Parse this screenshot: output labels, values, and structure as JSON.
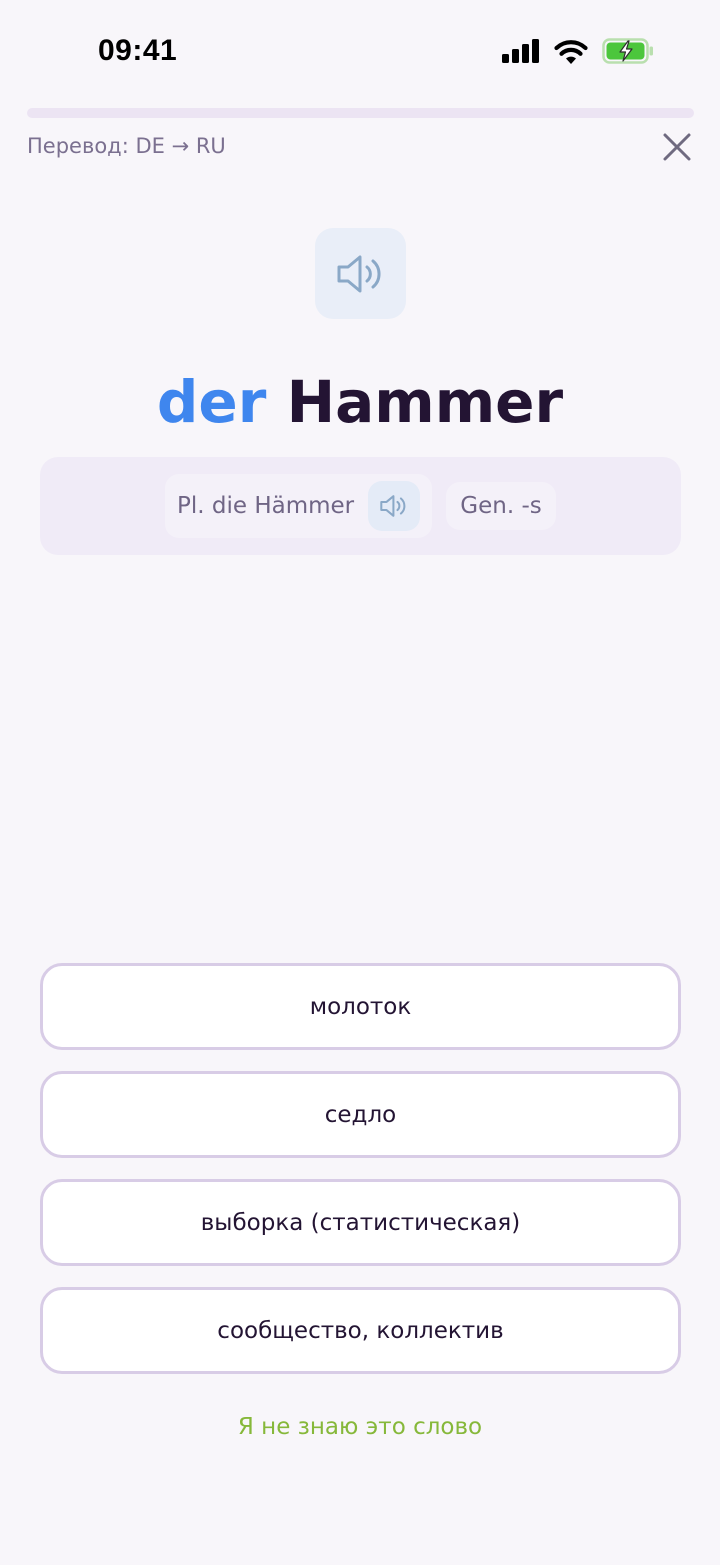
{
  "status_bar": {
    "time": "09:41",
    "icons": [
      "cellular-signal-icon",
      "wifi-icon",
      "battery-charging-icon"
    ]
  },
  "progress": {
    "value": 0
  },
  "header": {
    "mode_label": "Перевод: DE → RU",
    "close_icon": "close-icon"
  },
  "word": {
    "article": "der",
    "noun": "Hammer",
    "speaker_icon": "speaker-icon"
  },
  "forms": {
    "plural": "Pl. die Hämmer",
    "genitive": "Gen. -s"
  },
  "answers": [
    {
      "label": "молоток"
    },
    {
      "label": "седло"
    },
    {
      "label": "выборка (статистическая)"
    },
    {
      "label": "сообщество, коллектив"
    }
  ],
  "dont_know_label": "Я не знаю это слово",
  "colors": {
    "article": "#3f86ee",
    "word": "#231433",
    "dont_know": "#86b83a",
    "answer_border": "#d8cce6",
    "background": "#f8f6fa"
  }
}
